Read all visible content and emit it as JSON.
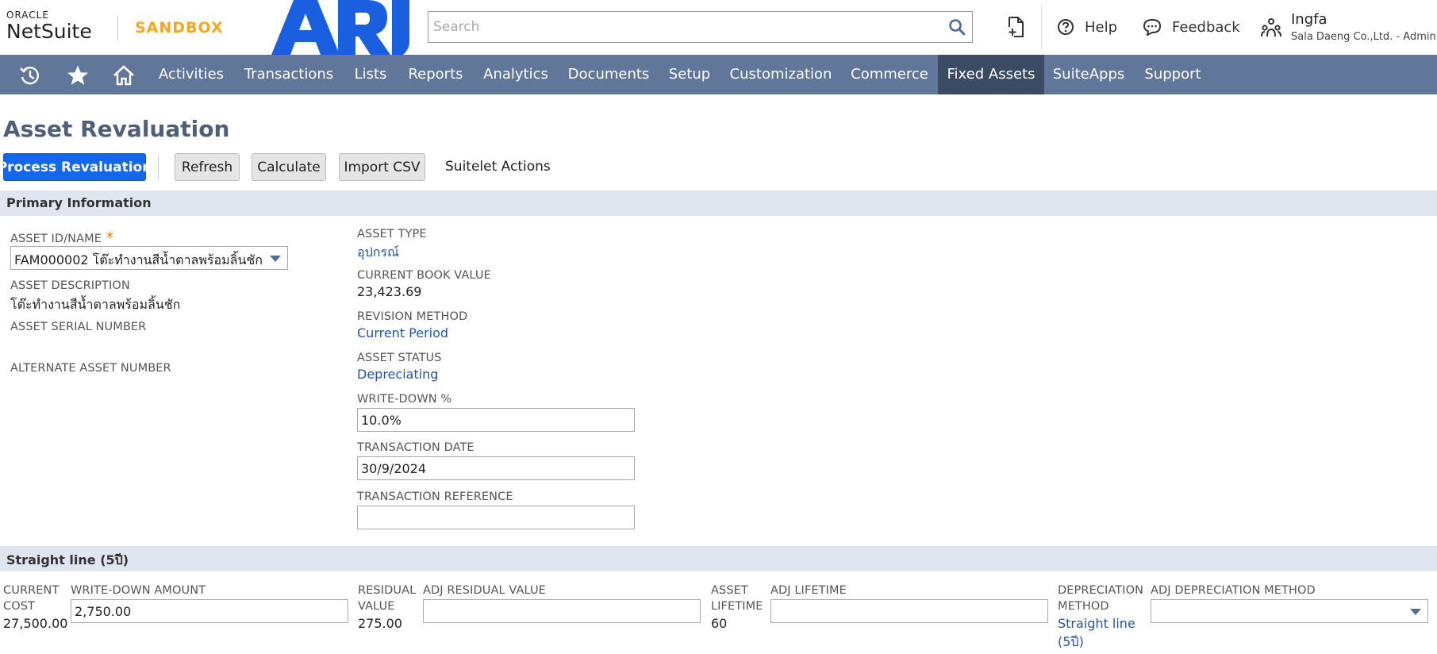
{
  "header": {
    "oracle_text": "ORACLE",
    "netsuite_text": "NetSuite",
    "sandbox_text": "SANDBOX",
    "search_placeholder": "Search",
    "help_label": "Help",
    "feedback_label": "Feedback",
    "user_name": "Ingfa",
    "user_company": "Sala Daeng Co.,Ltd. - Administrator"
  },
  "nav": {
    "items": [
      {
        "label": "Activities"
      },
      {
        "label": "Transactions"
      },
      {
        "label": "Lists"
      },
      {
        "label": "Reports"
      },
      {
        "label": "Analytics"
      },
      {
        "label": "Documents"
      },
      {
        "label": "Setup"
      },
      {
        "label": "Customization"
      },
      {
        "label": "Commerce"
      },
      {
        "label": "Fixed Assets"
      },
      {
        "label": "SuiteApps"
      },
      {
        "label": "Support"
      }
    ],
    "active": "Fixed Assets"
  },
  "page": {
    "title": "Asset Revaluation"
  },
  "actions": {
    "process_revaluation": "Process Revaluation",
    "refresh": "Refresh",
    "calculate": "Calculate",
    "import_csv": "Import CSV",
    "suitelet_actions": "Suitelet Actions"
  },
  "primary": {
    "section_title": "Primary Information",
    "asset_id_label": "ASSET ID/NAME",
    "asset_id_required": "*",
    "asset_id_value": "FAM000002 โต๊ะทำงานสีน้ำตาลพร้อมลิ้นชัก",
    "asset_description_label": "ASSET DESCRIPTION",
    "asset_description_value": "โต๊ะทำงานสีน้ำตาลพร้อมลิ้นชัก",
    "asset_serial_label": "ASSET SERIAL NUMBER",
    "alternate_asset_label": "ALTERNATE ASSET NUMBER",
    "asset_type_label": "ASSET TYPE",
    "asset_type_value": "อุปกรณ์",
    "current_book_value_label": "CURRENT BOOK VALUE",
    "current_book_value": "23,423.69",
    "revision_method_label": "REVISION METHOD",
    "revision_method_value": "Current Period",
    "asset_status_label": "ASSET STATUS",
    "asset_status_value": "Depreciating",
    "write_down_pct_label": "WRITE-DOWN %",
    "write_down_pct_value": "10.0%",
    "transaction_date_label": "TRANSACTION DATE",
    "transaction_date_value": "30/9/2024",
    "transaction_reference_label": "TRANSACTION REFERENCE",
    "transaction_reference_value": ""
  },
  "straight_line": {
    "section_title": "Straight line (5ปี)",
    "current_cost_label_1": "CURRENT",
    "current_cost_label_2": "COST",
    "current_cost_value": "27,500.00",
    "write_down_amount_label": "WRITE-DOWN AMOUNT",
    "write_down_amount_value": "2,750.00",
    "residual_value_label_1": "RESIDUAL",
    "residual_value_label_2": "VALUE",
    "residual_value": "275.00",
    "adj_residual_value_label": "ADJ RESIDUAL VALUE",
    "adj_residual_value": "",
    "asset_lifetime_label_1": "ASSET",
    "asset_lifetime_label_2": "LIFETIME",
    "asset_lifetime_value": "60",
    "adj_lifetime_label": "ADJ LIFETIME",
    "adj_lifetime_value": "",
    "depreciation_method_label_1": "DEPRECIATION",
    "depreciation_method_label_2": "METHOD",
    "depreciation_method_value_1": "Straight line",
    "depreciation_method_value_2": "(5ปี)",
    "adj_depreciation_method_label": "ADJ DEPRECIATION METHOD",
    "adj_depreciation_method_value": ""
  },
  "colors": {
    "nav_bg": "#607799",
    "nav_active": "#3a4b63",
    "primary_button": "#1467e8",
    "sandbox": "#f5a623",
    "ari_logo": "#1a5fe0",
    "link": "#255599",
    "section_bg": "#e0e6ef"
  },
  "icons": {
    "search": "search-icon",
    "recent_records": "recent-records-icon",
    "help": "help-circle-icon",
    "feedback": "chat-bubble-icon",
    "user": "user-roles-icon",
    "history": "history-icon",
    "star": "star-icon",
    "home": "home-icon"
  }
}
